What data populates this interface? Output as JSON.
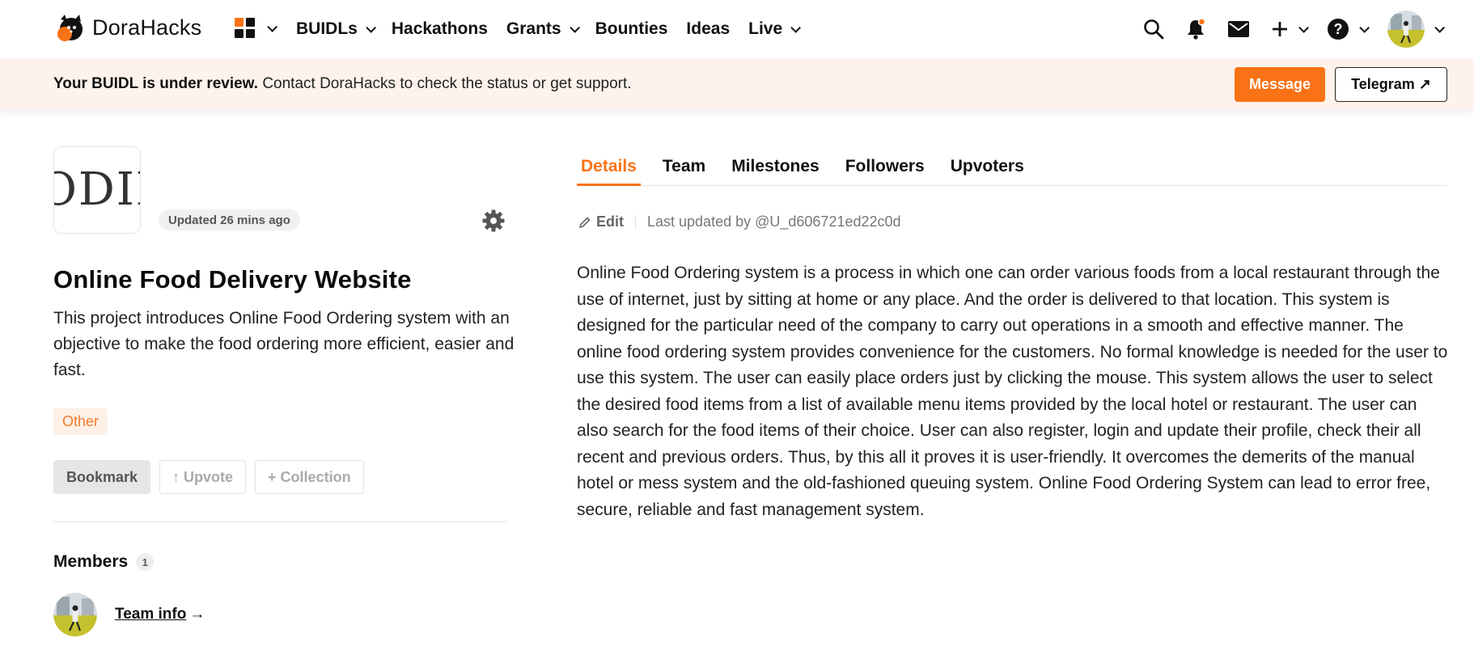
{
  "nav": {
    "brand": "DoraHacks",
    "items": [
      {
        "label": "BUIDLs",
        "has_menu": true
      },
      {
        "label": "Hackathons",
        "has_menu": false
      },
      {
        "label": "Grants",
        "has_menu": true
      },
      {
        "label": "Bounties",
        "has_menu": false
      },
      {
        "label": "Ideas",
        "has_menu": false
      },
      {
        "label": "Live",
        "has_menu": true
      }
    ],
    "icons": [
      "search-icon",
      "bell-icon",
      "mail-icon",
      "plus-icon",
      "help-icon",
      "avatar"
    ]
  },
  "banner": {
    "bold": "Your BUIDL is under review.",
    "text": " Contact DoraHacks to check the status or get support.",
    "message_label": "Message",
    "telegram_label": "Telegram ↗"
  },
  "project": {
    "thumb_text": "ODIE",
    "updated": "Updated 26 mins ago",
    "title": "Online Food Delivery Website",
    "description": "This project introduces Online Food Ordering system with an objective to make the food ordering more efficient, easier and fast.",
    "tag": "Other",
    "bookmark_label": "Bookmark",
    "upvote_label": "↑ Upvote",
    "collection_label": "+ Collection",
    "members_label": "Members",
    "members_count": "1",
    "team_info_label": "Team info",
    "team_info_arrow": "→"
  },
  "tabs": [
    {
      "label": "Details",
      "active": true
    },
    {
      "label": "Team",
      "active": false
    },
    {
      "label": "Milestones",
      "active": false
    },
    {
      "label": "Followers",
      "active": false
    },
    {
      "label": "Upvoters",
      "active": false
    }
  ],
  "details": {
    "edit_label": "Edit",
    "last_updated": "Last updated by @U_d606721ed22c0d",
    "body": "Online Food Ordering system is a process in which one can order various foods from a local restaurant through the use of internet, just by sitting at home or any place. And the order is delivered to that location. This system is designed for the particular need of the company to carry out operations in a smooth and effective manner. The online food ordering system provides convenience for the customers. No formal knowledge is needed for the user to use this system. The user can easily place orders just by clicking the mouse. This system allows the user to select the desired food items from a list of available menu items provided by the local hotel or restaurant. The user can also search for the food items of their choice. User can also register, login and update their profile, check their all recent and previous orders. Thus, by this all it proves it is user-friendly. It overcomes the demerits of the manual hotel or mess system and the old-fashioned queuing system. Online Food Ordering System can lead to error free, secure, reliable and fast management system."
  },
  "colors": {
    "accent": "#f97316",
    "banner_bg": "#fef3ec",
    "tag_bg": "#fef0e6",
    "tag_text": "#f27a2a"
  }
}
